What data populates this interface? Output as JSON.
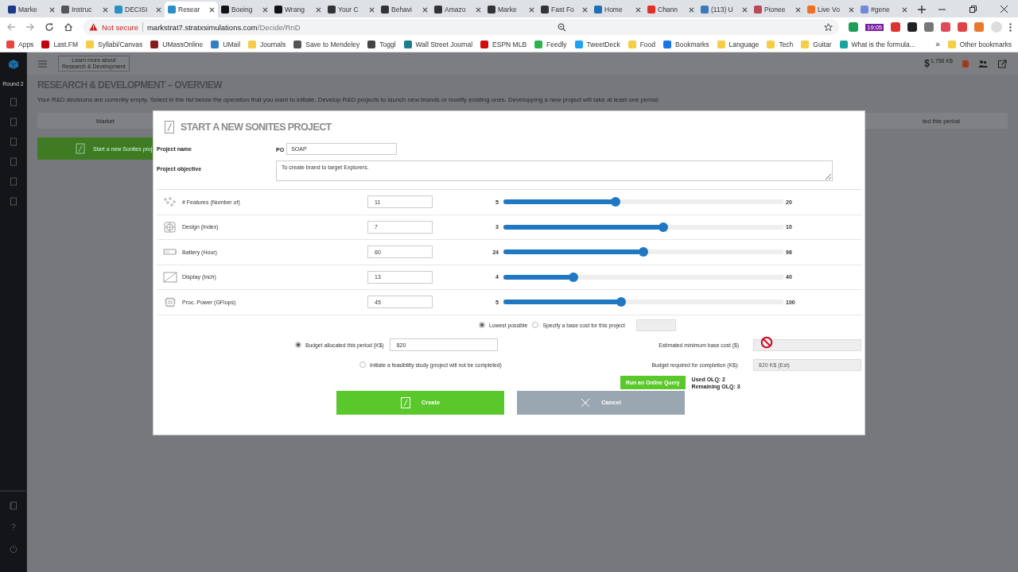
{
  "browser": {
    "tabs": [
      {
        "title": "Marke",
        "selected": false,
        "color": "#1a3a8a"
      },
      {
        "title": "Instruc",
        "selected": false,
        "color": "#555555"
      },
      {
        "title": "DECISI",
        "selected": false,
        "color": "#2a8fc4"
      },
      {
        "title": "Resear",
        "selected": true,
        "color": "#2a8fc4"
      },
      {
        "title": "Boeing",
        "selected": false,
        "color": "#111111"
      },
      {
        "title": "Wrang",
        "selected": false,
        "color": "#111111"
      },
      {
        "title": "Your C",
        "selected": false,
        "color": "#333333"
      },
      {
        "title": "Behavi",
        "selected": false,
        "color": "#333333"
      },
      {
        "title": "Amazo",
        "selected": false,
        "color": "#333333"
      },
      {
        "title": "Marke",
        "selected": false,
        "color": "#333333"
      },
      {
        "title": "Fast Fo",
        "selected": false,
        "color": "#333333"
      },
      {
        "title": "Home",
        "selected": false,
        "color": "#1f6fb5"
      },
      {
        "title": "Chann",
        "selected": false,
        "color": "#e52d27"
      },
      {
        "title": "(113) U",
        "selected": false,
        "color": "#3b79b8"
      },
      {
        "title": "Pionee",
        "selected": false,
        "color": "#b8485a"
      },
      {
        "title": "Live Vo",
        "selected": false,
        "color": "#f26f21"
      },
      {
        "title": "#gene",
        "selected": false,
        "color": "#7289da"
      }
    ],
    "security": "Not secure",
    "url_host": "markstrat7.stratxsimulations.com",
    "url_path": "/Decide/RnD",
    "extension_badge": "19:05",
    "bookmarks": [
      {
        "label": "Apps",
        "color": "#e8453c"
      },
      {
        "label": "Last.FM",
        "color": "#c3000d"
      },
      {
        "label": "Syllabi/Canvas",
        "color": "#f5cd47"
      },
      {
        "label": "UMassOnline",
        "color": "#881c1c"
      },
      {
        "label": "UMail",
        "color": "#2f7fc1"
      },
      {
        "label": "Journals",
        "color": "#f5cd47"
      },
      {
        "label": "Save to Mendeley",
        "color": "#555555"
      },
      {
        "label": "Toggl",
        "color": "#444444"
      },
      {
        "label": "Wall Street Journal",
        "color": "#1b7d8c"
      },
      {
        "label": "ESPN MLB",
        "color": "#d50a0a"
      },
      {
        "label": "Feedly",
        "color": "#2bb24c"
      },
      {
        "label": "TweetDeck",
        "color": "#1da1f2"
      },
      {
        "label": "Food",
        "color": "#f5cd47"
      },
      {
        "label": "Bookmarks",
        "color": "#1a73e8"
      },
      {
        "label": "Language",
        "color": "#f5cd47"
      },
      {
        "label": "Tech",
        "color": "#f5cd47"
      },
      {
        "label": "Guitar",
        "color": "#f5cd47"
      },
      {
        "label": "What is the formula...",
        "color": "#1aa39a"
      }
    ],
    "bookmarks_overflow": "»",
    "other_bookmarks": "Other bookmarks"
  },
  "app": {
    "round": "Round 2",
    "learn_more": [
      "Learn more about",
      "Research & Development"
    ],
    "cash_symbol": "$",
    "cash": "1,756 K$",
    "title": "RESEARCH & DEVELOPMENT – OVERVIEW",
    "description": "Your R&D decisions are currently empty. Select in the list below the operation that you want to initiate. Develop R&D projects to launch new brands or modify existing ones.  Developping a new project will take at least one period.",
    "table": {
      "columns": [
        "Market",
        "ted this period"
      ]
    },
    "start_button": "Start a new Sonites proj"
  },
  "dialog": {
    "title": "START A NEW SONITES PROJECT",
    "name_label": "Project name",
    "name_prefix": "PO",
    "name_value": "SOAP",
    "objective_label": "Project objective",
    "objective_value": "To create brand to target Explorers.",
    "attributes": [
      {
        "kind": "features",
        "label": "# Features (Number of)",
        "value": "11",
        "min": "5",
        "max": "20",
        "level": 0.4
      },
      {
        "kind": "design",
        "label": "Design (Index)",
        "value": "7",
        "min": "3",
        "max": "10",
        "level": 0.57
      },
      {
        "kind": "battery",
        "label": "Battery (Hour)",
        "value": "60",
        "min": "24",
        "max": "96",
        "level": 0.5
      },
      {
        "kind": "display",
        "label": "Display (Inch)",
        "value": "13",
        "min": "4",
        "max": "40",
        "level": 0.25
      },
      {
        "kind": "processor",
        "label": "Proc. Power (GFlops)",
        "value": "45",
        "min": "5",
        "max": "100",
        "level": 0.42
      }
    ],
    "cost_options": [
      {
        "label": "Lowest possible",
        "selected": true
      },
      {
        "label": "Specify a base cost for this project",
        "selected": false
      }
    ],
    "budget_options": [
      {
        "label": "Budget allocated this period (K$)",
        "selected": true,
        "value": "820"
      },
      {
        "label": "Initiate a feasibility study (project will not be completed)",
        "selected": false
      }
    ],
    "estimated_cost_label": "Estimated minimum base cost ($)",
    "budget_required_label": "Budget required for completion (K$):",
    "budget_required_value": "820 K$ (Est)",
    "query_button": "Run an Online Query",
    "used_olq": "Used OLQ: 2",
    "remaining_olq": "Remaining OLQ: 3",
    "create_button": "Create",
    "cancel_button": "Cancel"
  }
}
